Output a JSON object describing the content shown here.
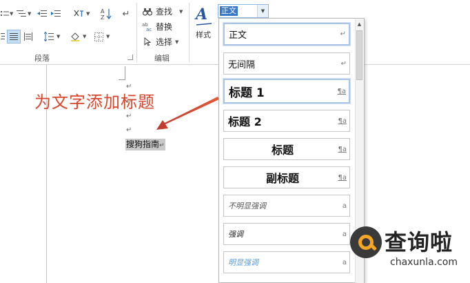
{
  "ribbon": {
    "groups": {
      "paragraph": "段落",
      "editing": "编辑"
    },
    "editing": {
      "find": "查找",
      "replace": "替换",
      "select": "选择"
    },
    "styles_button": "样式",
    "style_combo_value": "正文"
  },
  "document": {
    "annotation": "为文字添加标题",
    "selected_text": "搜狗指南",
    "paragraph_mark": "↵"
  },
  "style_gallery": {
    "items": [
      {
        "label": "正文",
        "mark": "↵"
      },
      {
        "label": "无间隔",
        "mark": "↵"
      },
      {
        "label": "标题 1",
        "mark": "¶a"
      },
      {
        "label": "标题 2",
        "mark": "¶a"
      },
      {
        "label": "标题",
        "mark": "¶a"
      },
      {
        "label": "副标题",
        "mark": "¶a"
      },
      {
        "label": "不明显强调",
        "mark": "a"
      },
      {
        "label": "强调",
        "mark": "a"
      },
      {
        "label": "明显强调",
        "mark": "a"
      }
    ]
  },
  "watermark": {
    "brand": "查询啦",
    "domain": "chaxunla.com"
  },
  "colors": {
    "annotation_red": "#d9462b",
    "accent_blue": "#3a79c8",
    "intense_emphasis_blue": "#5b9bd5"
  }
}
